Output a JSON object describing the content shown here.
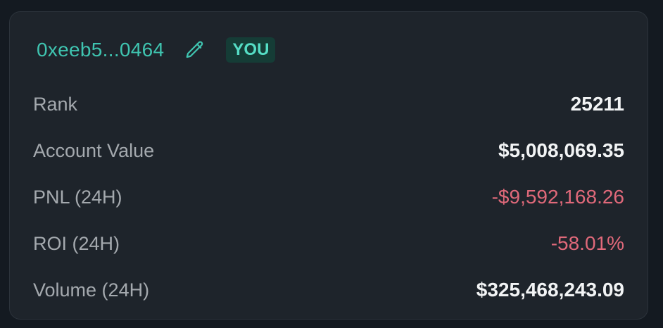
{
  "header": {
    "address": "0xeeb5...0464",
    "badge": "YOU",
    "edit_icon": "pencil-icon"
  },
  "stats": [
    {
      "label": "Rank",
      "value": "25211",
      "negative": false
    },
    {
      "label": "Account Value",
      "value": "$5,008,069.35",
      "negative": false
    },
    {
      "label": "PNL (24H)",
      "value": "-$9,592,168.26",
      "negative": true
    },
    {
      "label": "ROI (24H)",
      "value": "-58.01%",
      "negative": true
    },
    {
      "label": "Volume (24H)",
      "value": "$325,468,243.09",
      "negative": false
    }
  ],
  "colors": {
    "accent": "#3fc4b0",
    "negative": "#e0697a",
    "card_bg": "#1e242b",
    "page_bg": "#141a21"
  }
}
